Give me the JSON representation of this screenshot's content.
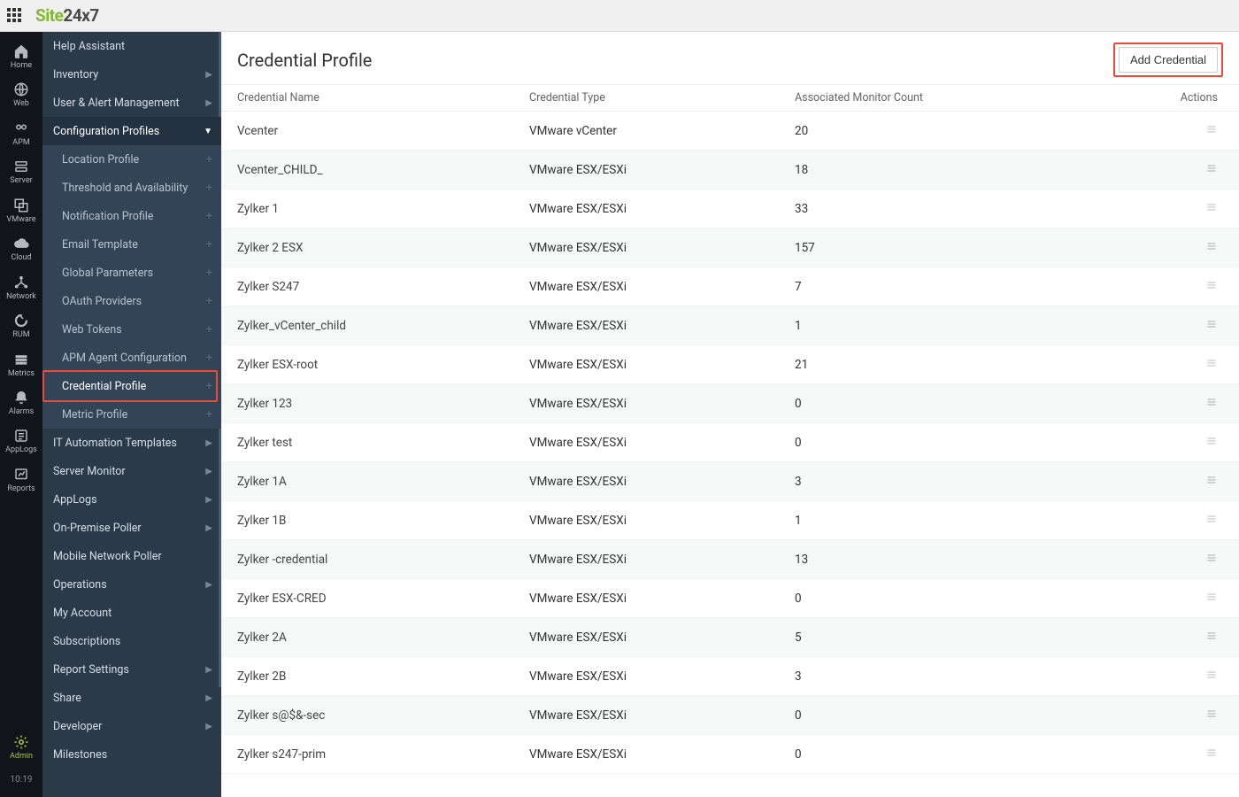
{
  "brand": {
    "part1": "Site",
    "part2": "24x7"
  },
  "clock": "10:19",
  "rail": [
    {
      "key": "home",
      "label": "Home"
    },
    {
      "key": "web",
      "label": "Web"
    },
    {
      "key": "apm",
      "label": "APM"
    },
    {
      "key": "server",
      "label": "Server"
    },
    {
      "key": "vmware",
      "label": "VMware"
    },
    {
      "key": "cloud",
      "label": "Cloud"
    },
    {
      "key": "network",
      "label": "Network"
    },
    {
      "key": "rum",
      "label": "RUM"
    },
    {
      "key": "metrics",
      "label": "Metrics"
    },
    {
      "key": "alarms",
      "label": "Alarms"
    },
    {
      "key": "applogs",
      "label": "AppLogs"
    },
    {
      "key": "reports",
      "label": "Reports"
    },
    {
      "key": "admin",
      "label": "Admin",
      "active": true,
      "bottom": true
    }
  ],
  "side": {
    "items": [
      {
        "label": "Help Assistant"
      },
      {
        "label": "Inventory",
        "arrow": true
      },
      {
        "label": "User & Alert Management",
        "arrow": true
      },
      {
        "label": "Configuration Profiles",
        "arrow": true,
        "expanded": true
      },
      {
        "label": "Location Profile",
        "sub": true,
        "plus": true
      },
      {
        "label": "Threshold and Availability",
        "sub": true,
        "plus": true
      },
      {
        "label": "Notification Profile",
        "sub": true,
        "plus": true
      },
      {
        "label": "Email Template",
        "sub": true,
        "plus": true
      },
      {
        "label": "Global Parameters",
        "sub": true,
        "plus": true
      },
      {
        "label": "OAuth Providers",
        "sub": true,
        "plus": true
      },
      {
        "label": "Web Tokens",
        "sub": true,
        "plus": true
      },
      {
        "label": "APM Agent Configuration",
        "sub": true,
        "plus": true
      },
      {
        "label": "Credential Profile",
        "sub": true,
        "plus": true,
        "highlight": true
      },
      {
        "label": "Metric Profile",
        "sub": true,
        "plus": true
      },
      {
        "label": "IT Automation Templates",
        "arrow": true
      },
      {
        "label": "Server Monitor",
        "arrow": true
      },
      {
        "label": "AppLogs",
        "arrow": true
      },
      {
        "label": "On-Premise Poller",
        "arrow": true
      },
      {
        "label": "Mobile Network Poller"
      },
      {
        "label": "Operations",
        "arrow": true
      },
      {
        "label": "My Account"
      },
      {
        "label": "Subscriptions"
      },
      {
        "label": "Report Settings",
        "arrow": true
      },
      {
        "label": "Share",
        "arrow": true
      },
      {
        "label": "Developer",
        "arrow": true
      },
      {
        "label": "Milestones"
      }
    ]
  },
  "page": {
    "title": "Credential Profile",
    "add_button": "Add Credential",
    "columns": {
      "name": "Credential Name",
      "type": "Credential Type",
      "count": "Associated Monitor Count",
      "actions": "Actions"
    },
    "rows": [
      {
        "name": "Vcenter",
        "type": "VMware vCenter",
        "count": "20"
      },
      {
        "name": "Vcenter_CHILD_",
        "type": "VMware ESX/ESXi",
        "count": "18"
      },
      {
        "name": "Zylker 1",
        "type": "VMware ESX/ESXi",
        "count": "33"
      },
      {
        "name": "Zylker 2 ESX",
        "type": "VMware ESX/ESXi",
        "count": "157"
      },
      {
        "name": "Zylker S247",
        "type": "VMware ESX/ESXi",
        "count": "7"
      },
      {
        "name": "Zylker_vCenter_child",
        "type": "VMware ESX/ESXi",
        "count": "1"
      },
      {
        "name": "Zylker ESX-root",
        "type": "VMware ESX/ESXi",
        "count": "21"
      },
      {
        "name": "Zylker 123",
        "type": "VMware ESX/ESXi",
        "count": "0"
      },
      {
        "name": "Zylker test",
        "type": "VMware ESX/ESXi",
        "count": "0"
      },
      {
        "name": "Zylker 1A",
        "type": "VMware ESX/ESXi",
        "count": "3"
      },
      {
        "name": "Zylker 1B",
        "type": "VMware ESX/ESXi",
        "count": "1"
      },
      {
        "name": "Zylker -credential",
        "type": "VMware ESX/ESXi",
        "count": "13"
      },
      {
        "name": "Zylker ESX-CRED",
        "type": "VMware ESX/ESXi",
        "count": "0"
      },
      {
        "name": "Zylker 2A",
        "type": "VMware ESX/ESXi",
        "count": "5"
      },
      {
        "name": "Zylker 2B",
        "type": "VMware ESX/ESXi",
        "count": "3"
      },
      {
        "name": "Zylker s@$&-sec",
        "type": "VMware ESX/ESXi",
        "count": "0"
      },
      {
        "name": "Zylker s247-prim",
        "type": "VMware ESX/ESXi",
        "count": "0"
      }
    ]
  }
}
